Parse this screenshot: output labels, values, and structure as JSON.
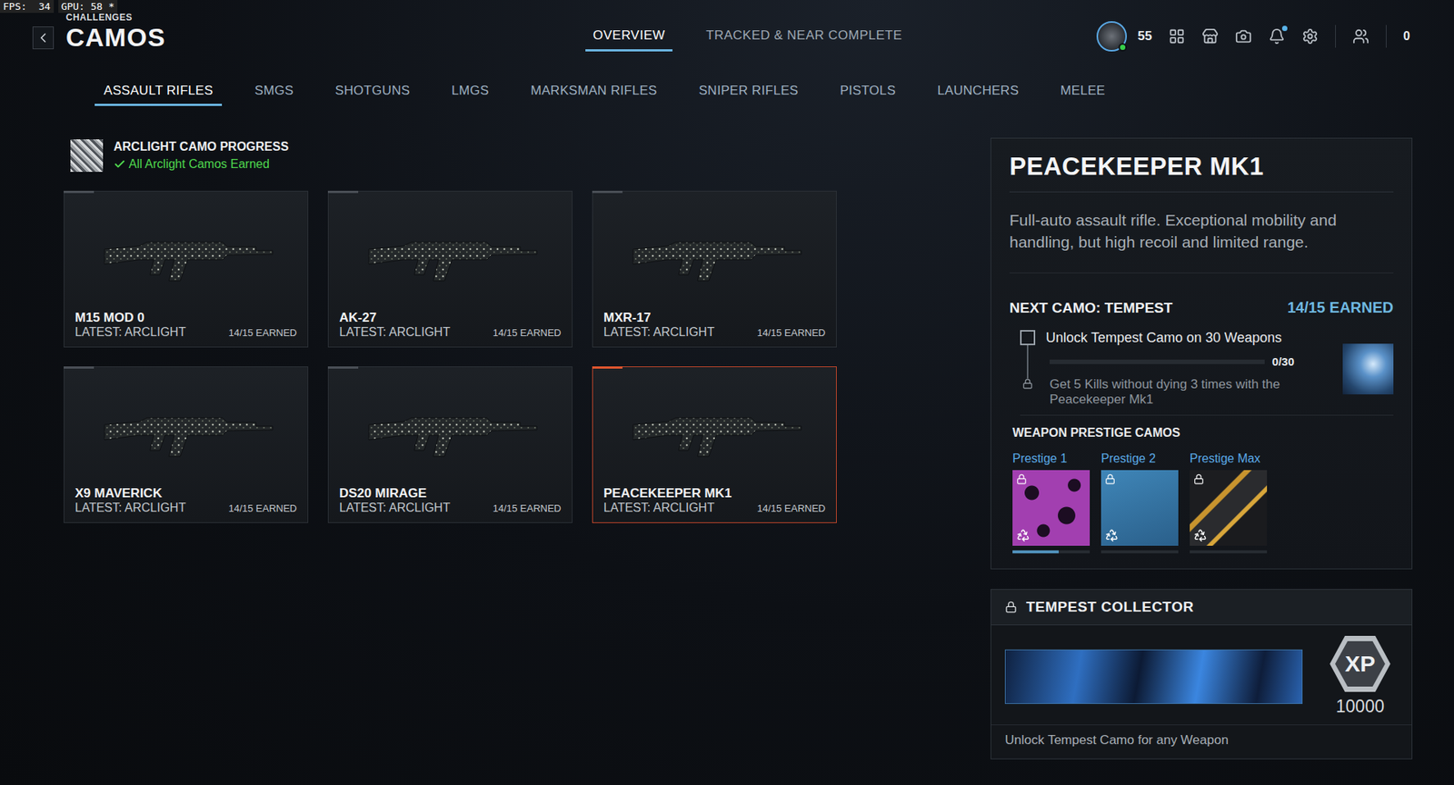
{
  "debug": {
    "fps": "FPS:  34",
    "gpu": "GPU: 58 *"
  },
  "header": {
    "breadcrumb": "CHALLENGES",
    "title": "CAMOS"
  },
  "top_tabs": [
    {
      "label": "OVERVIEW",
      "selected": true
    },
    {
      "label": "TRACKED & NEAR COMPLETE",
      "selected": false
    }
  ],
  "player": {
    "level": "55",
    "online": true,
    "notifications": true,
    "currency": "0"
  },
  "categories": [
    {
      "label": "ASSAULT RIFLES",
      "selected": true
    },
    {
      "label": "SMGS",
      "selected": false
    },
    {
      "label": "SHOTGUNS",
      "selected": false
    },
    {
      "label": "LMGS",
      "selected": false
    },
    {
      "label": "MARKSMAN RIFLES",
      "selected": false
    },
    {
      "label": "SNIPER RIFLES",
      "selected": false
    },
    {
      "label": "PISTOLS",
      "selected": false
    },
    {
      "label": "LAUNCHERS",
      "selected": false
    },
    {
      "label": "MELEE",
      "selected": false
    }
  ],
  "progress": {
    "title": "ARCLIGHT CAMO PROGRESS",
    "status": "All Arclight Camos Earned",
    "complete": true
  },
  "weapons": [
    {
      "name": "M15 MOD 0",
      "latest": "LATEST: ARCLIGHT",
      "earned": "14/15 EARNED",
      "selected": false
    },
    {
      "name": "AK-27",
      "latest": "LATEST: ARCLIGHT",
      "earned": "14/15 EARNED",
      "selected": false
    },
    {
      "name": "MXR-17",
      "latest": "LATEST: ARCLIGHT",
      "earned": "14/15 EARNED",
      "selected": false
    },
    {
      "name": "X9 MAVERICK",
      "latest": "LATEST: ARCLIGHT",
      "earned": "14/15 EARNED",
      "selected": false
    },
    {
      "name": "DS20 MIRAGE",
      "latest": "LATEST: ARCLIGHT",
      "earned": "14/15 EARNED",
      "selected": false
    },
    {
      "name": "PEACEKEEPER MK1",
      "latest": "LATEST: ARCLIGHT",
      "earned": "14/15 EARNED",
      "selected": true
    }
  ],
  "detail": {
    "title": "PEACEKEEPER MK1",
    "description": "Full-auto assault rifle. Exceptional mobility and handling, but high recoil and limited range.",
    "next_camo": "NEXT CAMO: TEMPEST",
    "earned": "14/15 EARNED",
    "challenge": {
      "title": "Unlock Tempest Camo on 30 Weapons",
      "checked": false,
      "progress": "0/30",
      "level": 0,
      "locked": true,
      "description": "Get 5 Kills without dying 3 times with the Peacekeeper Mk1"
    },
    "prestige_title": "WEAPON PRESTIGE CAMOS",
    "prestige": [
      {
        "label": "Prestige 1",
        "locked": true,
        "level": 0.6
      },
      {
        "label": "Prestige 2",
        "locked": true,
        "level": 0
      },
      {
        "label": "Prestige Max",
        "locked": true,
        "level": 0
      }
    ]
  },
  "collector": {
    "title": "TEMPEST COLLECTOR",
    "locked": true,
    "xp_badge": "XP",
    "xp": "10000",
    "description": "Unlock Tempest Camo for any Weapon"
  }
}
